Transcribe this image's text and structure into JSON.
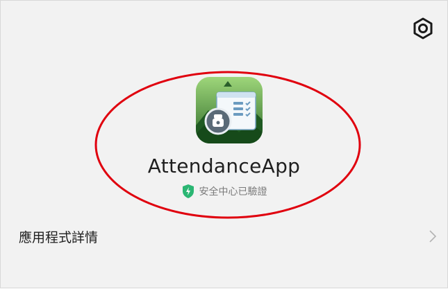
{
  "header": {
    "settings_icon": "gear-icon"
  },
  "app": {
    "name": "AttendanceApp",
    "icon": "attendance-app-icon",
    "verified_text": "安全中心已驗證",
    "verified_icon": "shield-icon",
    "verified_color": "#2bb673"
  },
  "menu": {
    "details_label": "應用程式詳情",
    "details_chevron": "chevron-right-icon"
  },
  "annotation": {
    "highlight_color": "#e0000e"
  }
}
